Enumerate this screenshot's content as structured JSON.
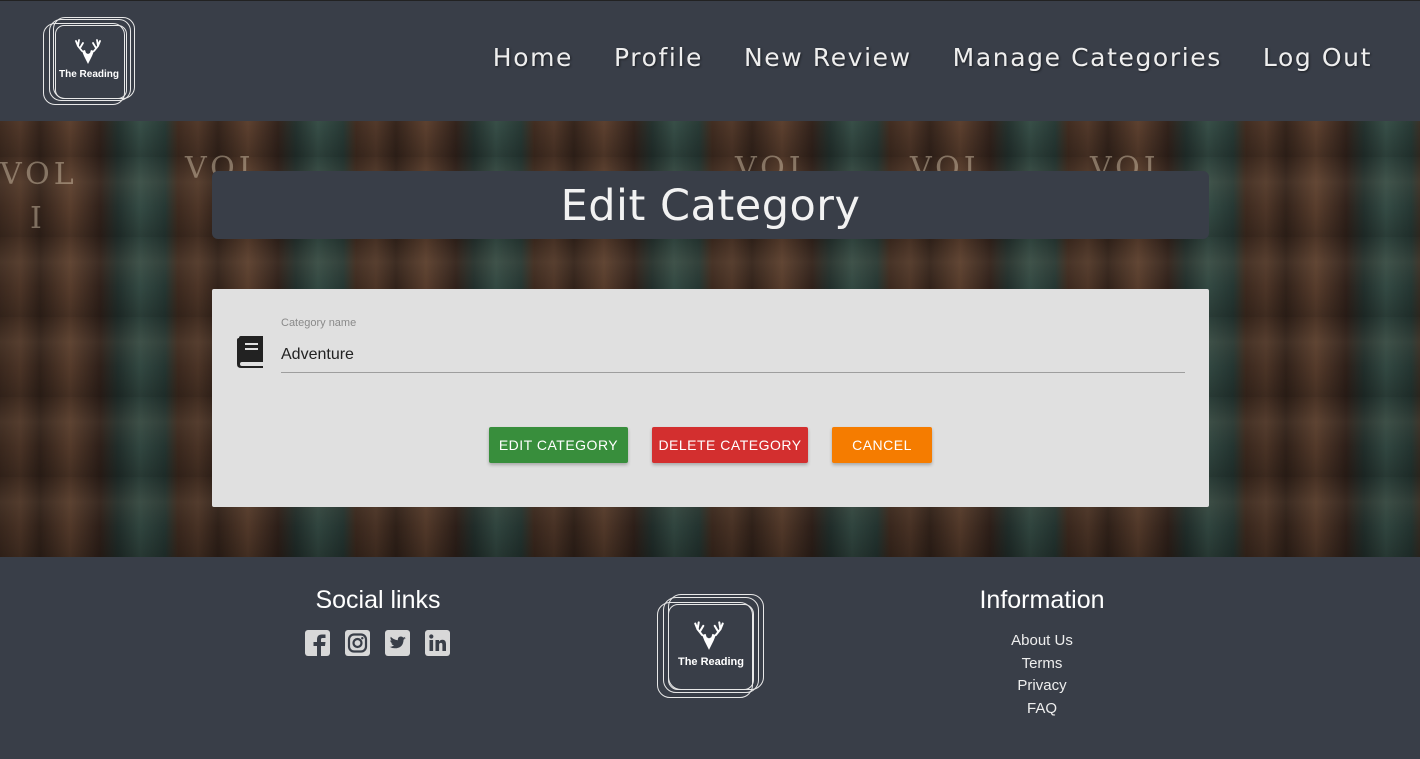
{
  "brand": {
    "name": "The Reading"
  },
  "nav": {
    "items": [
      {
        "label": "Home"
      },
      {
        "label": "Profile"
      },
      {
        "label": "New Review"
      },
      {
        "label": "Manage Categories"
      },
      {
        "label": "Log Out"
      }
    ]
  },
  "page": {
    "title": "Edit Category"
  },
  "form": {
    "category_label": "Category name",
    "category_value": "Adventure",
    "category_icon": "book-icon",
    "buttons": {
      "edit": "Edit Category",
      "delete": "Delete Category",
      "cancel": "Cancel"
    }
  },
  "hero": {
    "spine_texts": [
      "VOL",
      "I",
      "VOL",
      "VOL",
      "VOL",
      "VOL"
    ]
  },
  "colors": {
    "header_bg": "#393e48",
    "edit_button": "#388e3c",
    "delete_button": "#d32f2f",
    "cancel_button": "#f57c00",
    "card_bg": "#e0e0e0"
  },
  "footer": {
    "social_title": "Social links",
    "social_icons": [
      "facebook-icon",
      "instagram-icon",
      "twitter-icon",
      "linkedin-icon"
    ],
    "info_title": "Information",
    "info_links": [
      {
        "label": "About Us"
      },
      {
        "label": "Terms"
      },
      {
        "label": "Privacy"
      },
      {
        "label": "FAQ"
      }
    ]
  }
}
